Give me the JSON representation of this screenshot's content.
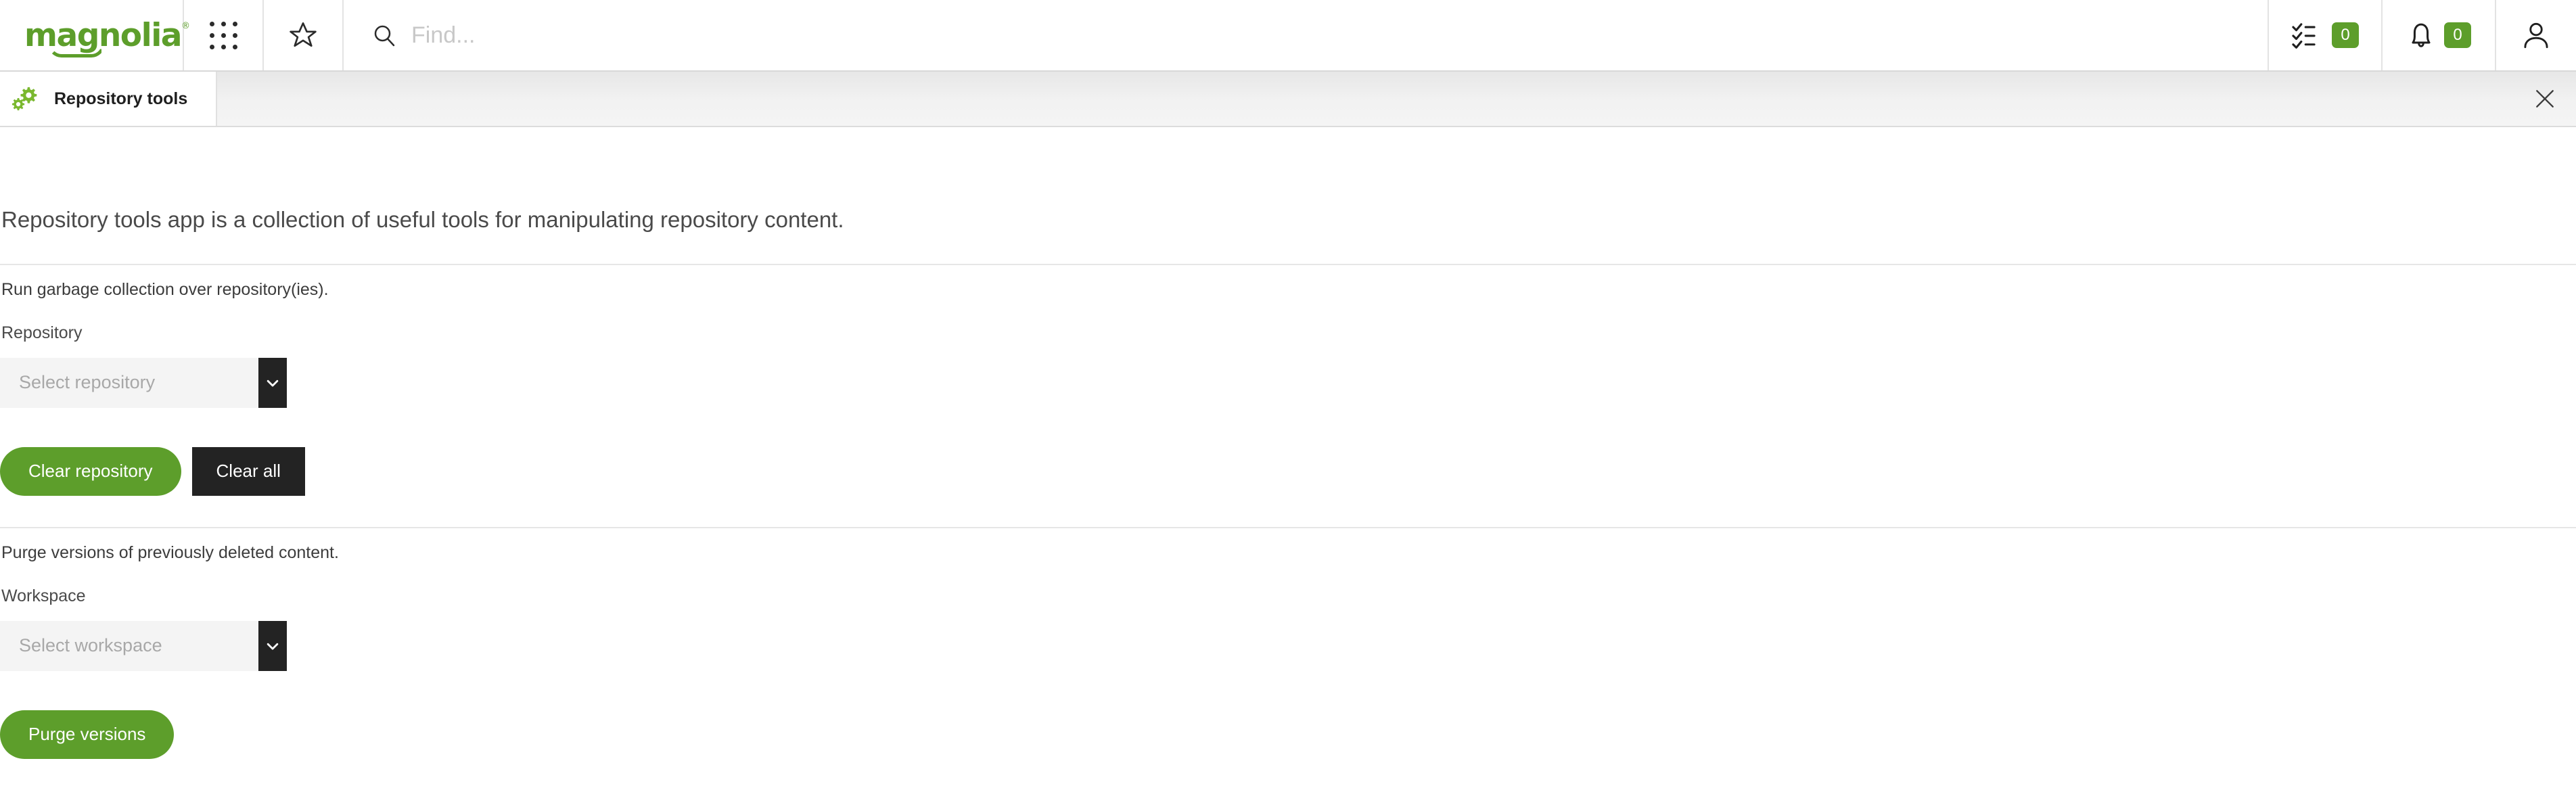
{
  "header": {
    "logo_text": "magnolia",
    "logo_registered": "®",
    "launcher_icon": "app-grid-icon",
    "favorites_icon": "star-icon",
    "search": {
      "icon": "search-icon",
      "value": "",
      "placeholder": "Find..."
    },
    "tasks": {
      "icon": "tasks-checklist-icon",
      "badge": "0"
    },
    "notifications": {
      "icon": "bell-icon",
      "badge": "0"
    },
    "user": {
      "icon": "user-avatar-icon"
    }
  },
  "tabbar": {
    "tab": {
      "icon": "gears-icon",
      "label": "Repository tools"
    },
    "close_icon": "close-icon"
  },
  "main": {
    "intro": "Repository tools app is a collection of useful tools for manipulating repository content.",
    "sections": [
      {
        "title": "Run garbage collection over repository(ies).",
        "field_label": "Repository",
        "select_value": "",
        "select_placeholder": "Select repository",
        "chevron_icon": "chevron-down-icon",
        "primary_button": "Clear repository",
        "secondary_button": "Clear all"
      },
      {
        "title": "Purge versions of previously deleted content.",
        "field_label": "Workspace",
        "select_value": "",
        "select_placeholder": "Select workspace",
        "chevron_icon": "chevron-down-icon",
        "primary_button": "Purge versions"
      }
    ]
  },
  "colors": {
    "brand_green": "#5d9e2b",
    "dark": "#232323",
    "field_bg": "#f4f4f4",
    "text": "#4a4a4a"
  }
}
